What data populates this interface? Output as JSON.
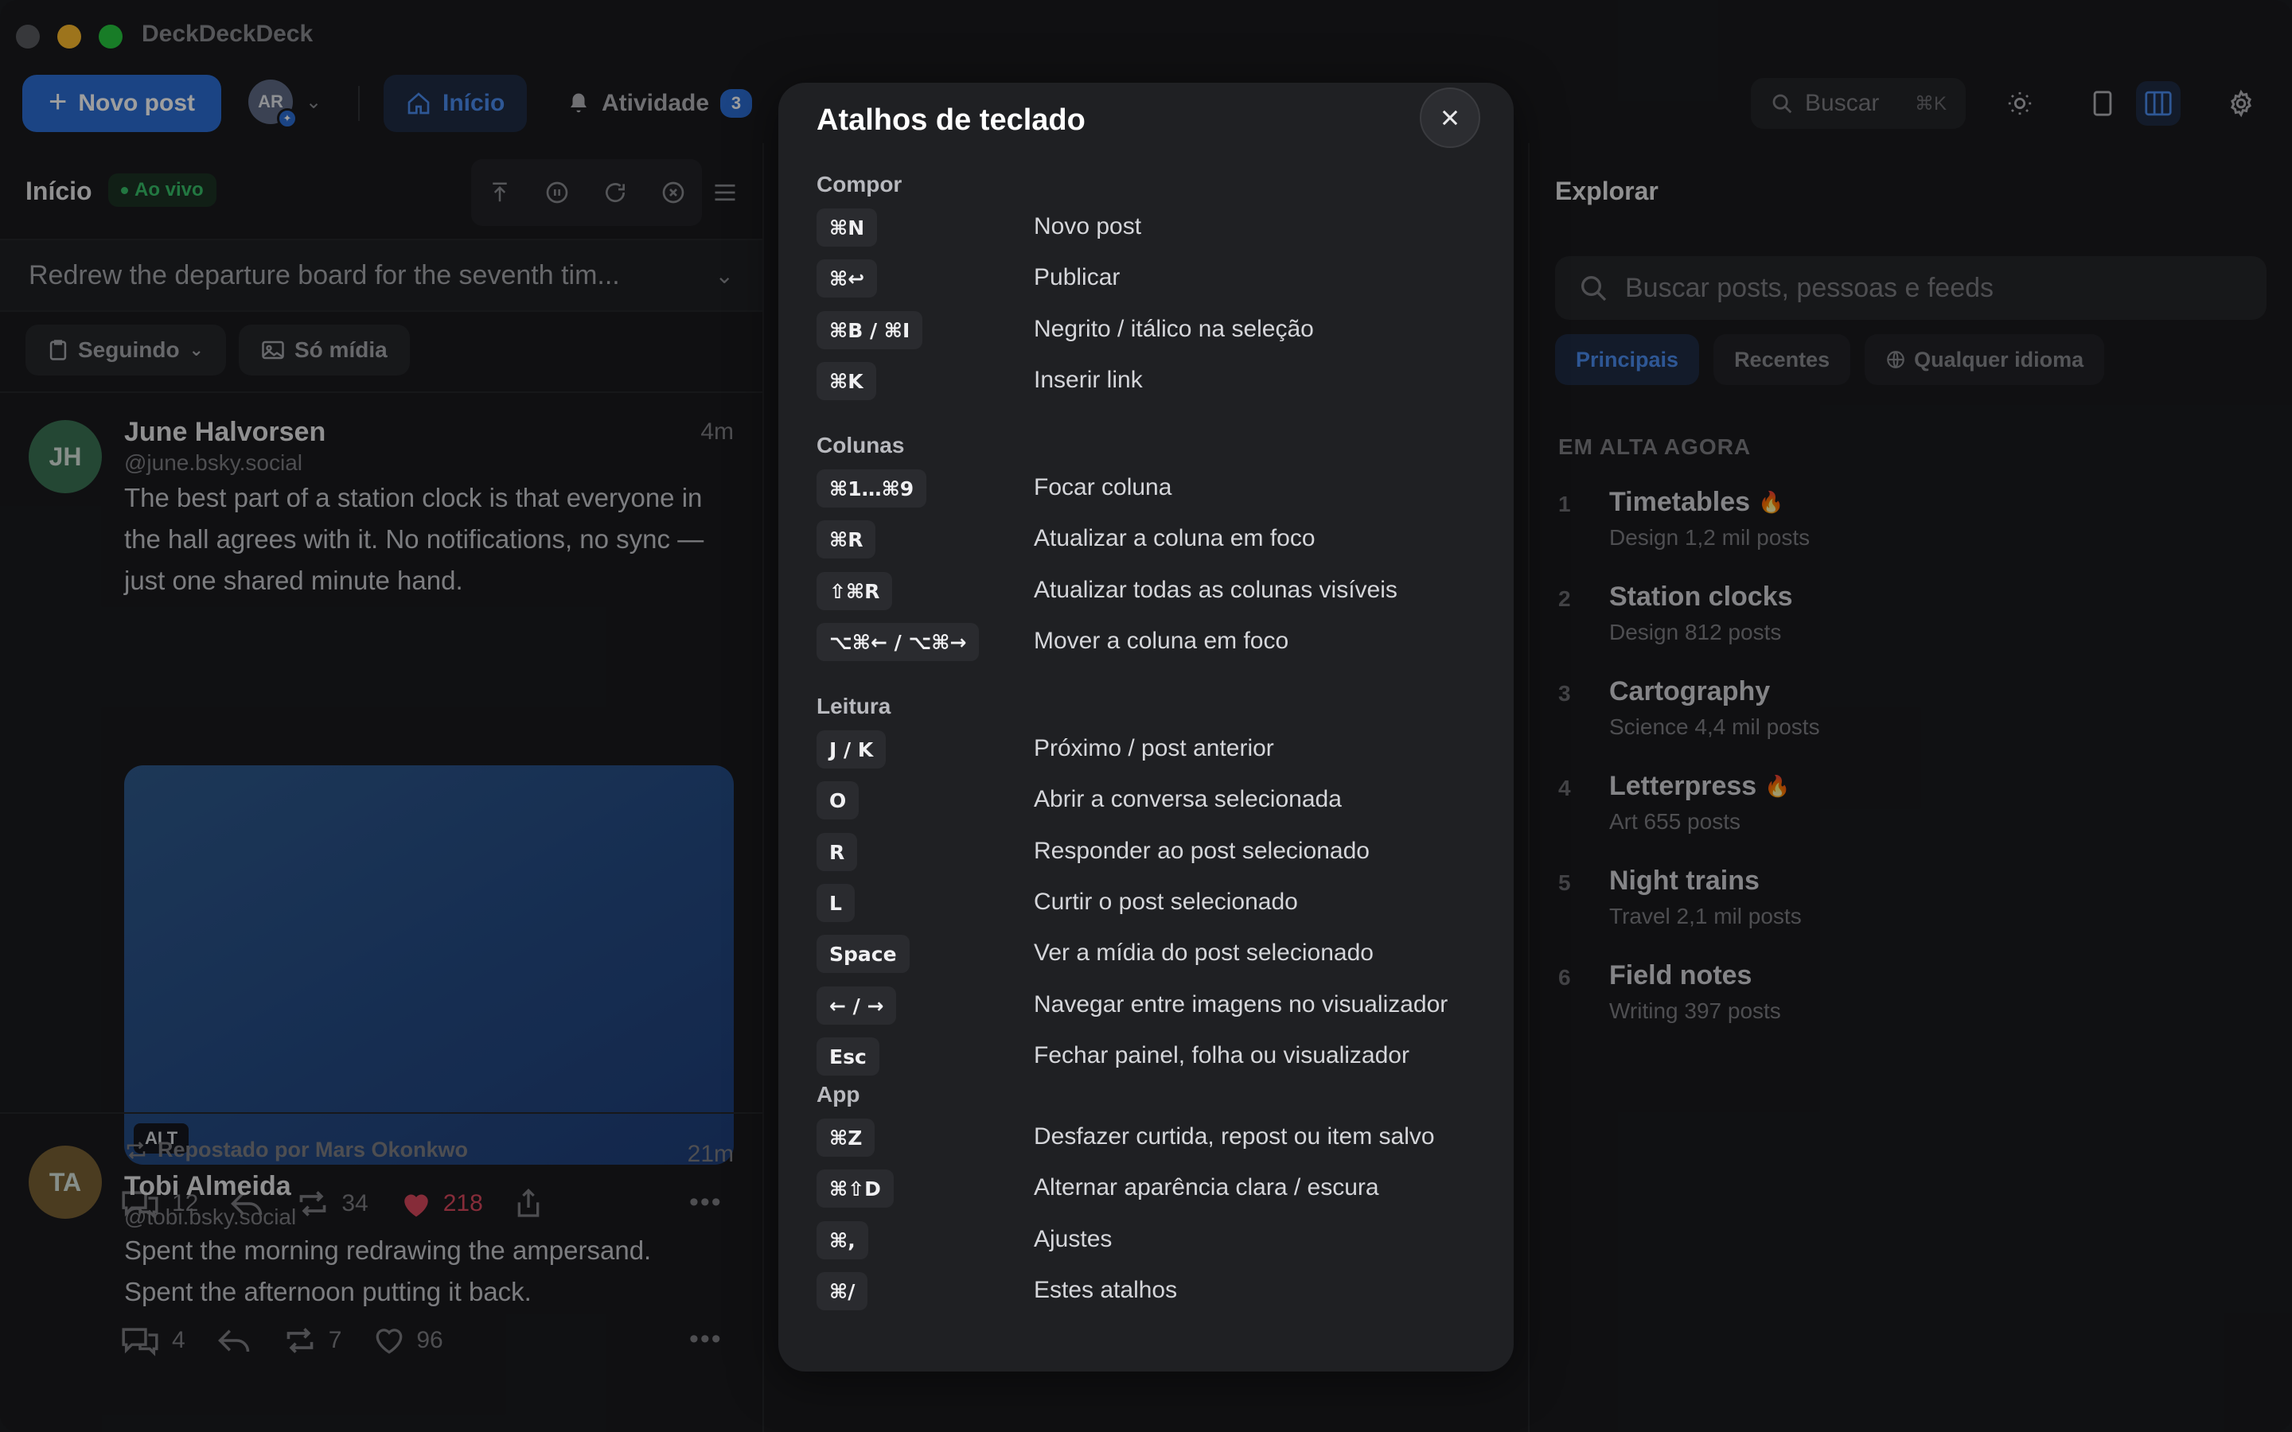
{
  "window": {
    "app_title": "DeckDeckDeck"
  },
  "toolbar": {
    "new_post": "Novo post",
    "avatar_initials": "AR",
    "home_tab": "Início",
    "activity_tab": "Atividade",
    "activity_count": "3",
    "search_placeholder": "Buscar",
    "search_shortcut": "⌘K"
  },
  "left_column": {
    "title": "Início",
    "live_label": "Ao vivo",
    "thread_preview": "Redrew the departure board for the seventh tim...",
    "filters": [
      "Seguindo",
      "Só mídia"
    ],
    "posts": [
      {
        "initials": "JH",
        "name": "June Halvorsen",
        "handle": "@june.bsky.social",
        "time": "4m",
        "text": "The best part of a station clock is that everyone in the hall agrees with it. No notifications, no sync — just one shared minute hand.",
        "alt_label": "ALT",
        "replies": "12",
        "reposts": "34",
        "likes": "218"
      },
      {
        "initials": "TA",
        "repost_by": "Repostado por Mars Okonkwo",
        "name": "Tobi Almeida",
        "handle": "@tobi.bsky.social",
        "time": "21m",
        "text_line1": "Spent the morning redrawing the ampersand.",
        "text_line2": "Spent the afternoon putting it back.",
        "replies": "4",
        "reposts": "7",
        "likes": "96"
      }
    ]
  },
  "right_column": {
    "title": "Explorar",
    "search_placeholder": "Buscar posts, pessoas e feeds",
    "chips": [
      "Principais",
      "Recentes",
      "Qualquer idioma"
    ],
    "trending_header": "EM ALTA AGORA",
    "trends": [
      {
        "rank": "1",
        "name": "Timetables",
        "meta": "Design 1,2 mil posts",
        "hot": true
      },
      {
        "rank": "2",
        "name": "Station clocks",
        "meta": "Design 812 posts",
        "hot": false
      },
      {
        "rank": "3",
        "name": "Cartography",
        "meta": "Science 4,4 mil posts",
        "hot": false
      },
      {
        "rank": "4",
        "name": "Letterpress",
        "meta": "Art 655 posts",
        "hot": true
      },
      {
        "rank": "5",
        "name": "Night trains",
        "meta": "Travel 2,1 mil posts",
        "hot": false
      },
      {
        "rank": "6",
        "name": "Field notes",
        "meta": "Writing 397 posts",
        "hot": false
      }
    ]
  },
  "modal": {
    "title": "Atalhos de teclado",
    "sections": [
      {
        "name": "Compor",
        "rows": [
          {
            "key": "⌘N",
            "desc": "Novo post"
          },
          {
            "key": "⌘↩",
            "desc": "Publicar"
          },
          {
            "key": "⌘B / ⌘I",
            "desc": "Negrito / itálico na seleção"
          },
          {
            "key": "⌘K",
            "desc": "Inserir link"
          }
        ]
      },
      {
        "name": "Colunas",
        "rows": [
          {
            "key": "⌘1…⌘9",
            "desc": "Focar coluna"
          },
          {
            "key": "⌘R",
            "desc": "Atualizar a coluna em foco"
          },
          {
            "key": "⇧⌘R",
            "desc": "Atualizar todas as colunas visíveis"
          },
          {
            "key": "⌥⌘← / ⌥⌘→",
            "desc": "Mover a coluna em foco"
          }
        ]
      },
      {
        "name": "Leitura",
        "rows": [
          {
            "key": "J / K",
            "desc": "Próximo / post anterior"
          },
          {
            "key": "O",
            "desc": "Abrir a conversa selecionada"
          },
          {
            "key": "R",
            "desc": "Responder ao post selecionado"
          },
          {
            "key": "L",
            "desc": "Curtir o post selecionado"
          },
          {
            "key": "Space",
            "desc": "Ver a mídia do post selecionado"
          },
          {
            "key": "← / →",
            "desc": "Navegar entre imagens no visualizador"
          },
          {
            "key": "Esc",
            "desc": "Fechar painel, folha ou visualizador"
          }
        ]
      },
      {
        "name": "App",
        "rows": [
          {
            "key": "⌘Z",
            "desc": "Desfazer curtida, repost ou item salvo"
          },
          {
            "key": "⌘⇧D",
            "desc": "Alternar aparência clara / escura"
          },
          {
            "key": "⌘,",
            "desc": "Ajustes"
          },
          {
            "key": "⌘/",
            "desc": "Estes atalhos"
          }
        ]
      }
    ]
  },
  "colors": {
    "accent": "#2d6fd6",
    "live": "#38c06a",
    "like": "#d9475d",
    "background": "#1a1b1e"
  }
}
